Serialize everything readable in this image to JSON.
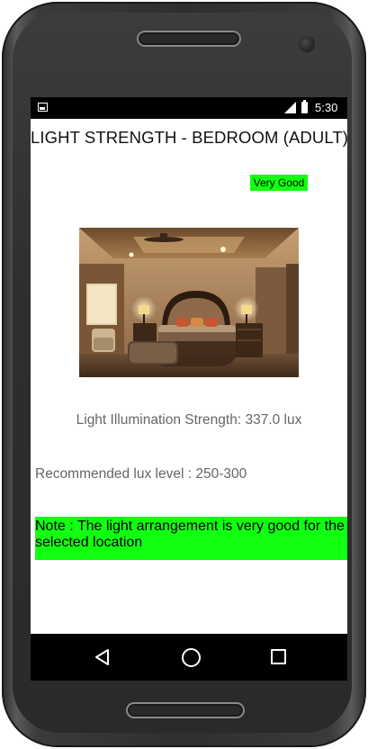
{
  "status_bar": {
    "time": "5:30",
    "icons": [
      "image-icon",
      "signal-icon",
      "battery-icon"
    ]
  },
  "header": {
    "title": "LIGHT STRENGTH - BEDROOM (ADULT)"
  },
  "rating": {
    "label": "Very Good",
    "color": "#11ff11"
  },
  "room_image": {
    "subject": "bedroom"
  },
  "readings": {
    "illumination_text": "Light Illumination Strength: 337.0 lux",
    "recommended_text": "Recommended lux level : 250-300"
  },
  "note": {
    "text": "Note : The light arrangement is very good for the selected location",
    "color": "#11ff11"
  },
  "nav_bar": {
    "buttons": [
      "back-icon",
      "home-icon",
      "recents-icon"
    ]
  }
}
